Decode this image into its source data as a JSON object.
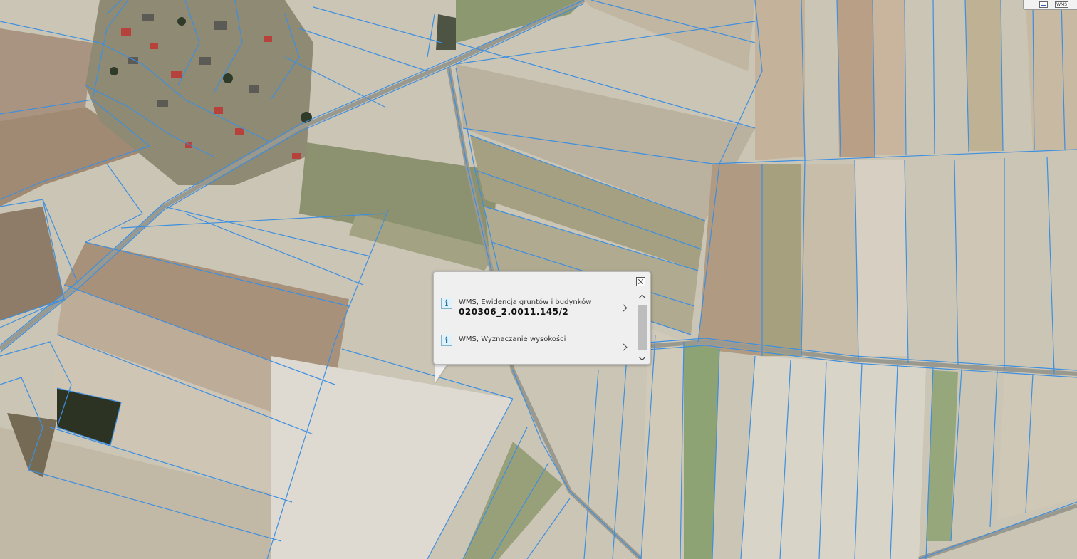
{
  "toolbar": {
    "legend_icon": "legend-icon",
    "wms_label": "WMS"
  },
  "popup": {
    "close_icon": "close-icon",
    "items": [
      {
        "icon": "info-icon",
        "title": "WMS, Ewidencja gruntów i budynków",
        "value": "020306_2.0011.145/2"
      },
      {
        "icon": "info-icon",
        "title": "WMS, Wyznaczanie wysokości",
        "value": ""
      }
    ],
    "scroll_up_icon": "chevron-up-icon",
    "scroll_down_icon": "chevron-down-icon",
    "item_arrow_icon": "chevron-right-icon"
  },
  "colors": {
    "parcel_boundary": "#3d8fe0",
    "popup_background": "#efefef"
  }
}
